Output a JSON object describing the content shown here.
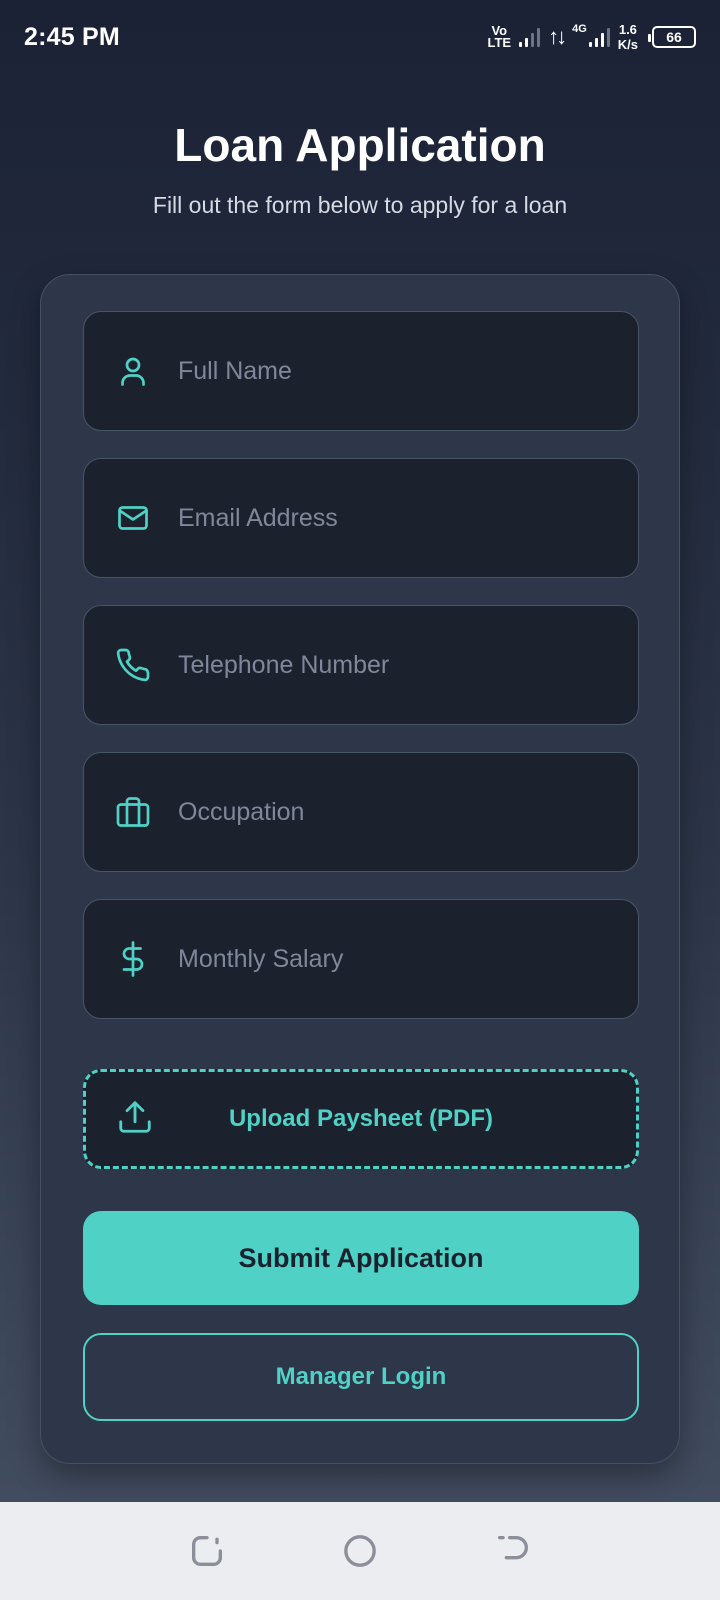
{
  "status_bar": {
    "time": "2:45 PM",
    "volte_top": "Vo",
    "volte_bottom": "LTE",
    "network_type": "4G",
    "speed_value": "1.6",
    "speed_unit": "K/s",
    "battery": "66"
  },
  "header": {
    "title": "Loan Application",
    "subtitle": "Fill out the form below to apply for a loan"
  },
  "form": {
    "full_name": {
      "placeholder": "Full Name",
      "value": "",
      "icon": "user-icon"
    },
    "email": {
      "placeholder": "Email Address",
      "value": "",
      "icon": "mail-icon"
    },
    "telephone": {
      "placeholder": "Telephone Number",
      "value": "",
      "icon": "phone-icon"
    },
    "occupation": {
      "placeholder": "Occupation",
      "value": "",
      "icon": "briefcase-icon"
    },
    "salary": {
      "placeholder": "Monthly Salary",
      "value": "",
      "icon": "dollar-icon"
    },
    "upload": {
      "label": "Upload Paysheet (PDF)",
      "icon": "upload-icon"
    },
    "submit_label": "Submit Application",
    "manager_label": "Manager Login"
  },
  "theme": {
    "accent": "#4fd1c5",
    "card_bg": "#2e3749",
    "field_bg": "#1c212e"
  },
  "nav": {
    "recents_icon": "recents-icon",
    "home_icon": "home-icon",
    "back_icon": "back-icon"
  }
}
